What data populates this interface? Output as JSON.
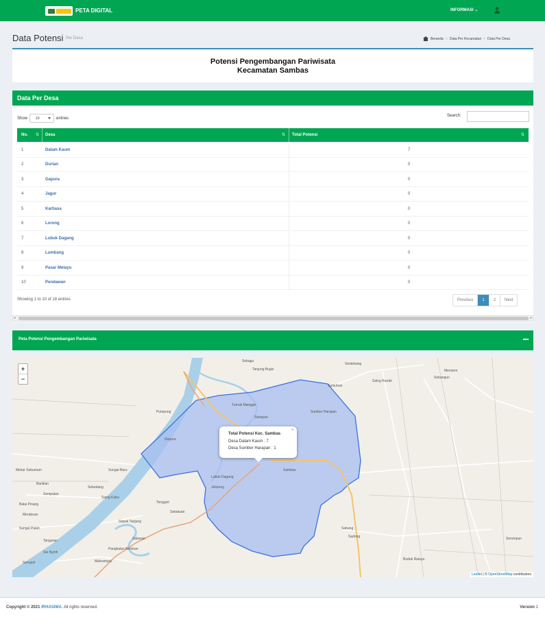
{
  "header": {
    "app_name": "PETA DIGITAL",
    "menu_label": "INFORMASI"
  },
  "page": {
    "title": "Data Potensi",
    "subtitle": "Per Desa"
  },
  "breadcrumb": [
    "Beranda",
    "Data Per Kecamatan",
    "Data Per Desa"
  ],
  "banner": {
    "line1": "Potensi Pengembangan Pariwisata",
    "line2": "Kecamatan Sambas"
  },
  "table_box": {
    "title": "Data Per Desa",
    "show_label": "Show",
    "entries_value": "10",
    "entries_label": "entries",
    "search_label": "Search:",
    "columns": [
      "No.",
      "Desa",
      "Total Potensi"
    ],
    "rows": [
      {
        "no": "1",
        "desa": "Dalam Kaum",
        "total": "7"
      },
      {
        "no": "2",
        "desa": "Durian",
        "total": "0"
      },
      {
        "no": "3",
        "desa": "Gapura",
        "total": "0"
      },
      {
        "no": "4",
        "desa": "Jagur",
        "total": "0"
      },
      {
        "no": "5",
        "desa": "Kartiasa",
        "total": "0"
      },
      {
        "no": "6",
        "desa": "Lorong",
        "total": "0"
      },
      {
        "no": "7",
        "desa": "Lubuk Dagang",
        "total": "0"
      },
      {
        "no": "8",
        "desa": "Lumbang",
        "total": "0"
      },
      {
        "no": "9",
        "desa": "Pasar Melayu",
        "total": "0"
      },
      {
        "no": "10",
        "desa": "Pendawan",
        "total": "0"
      }
    ],
    "info": "Showing 1 to 10 of 18 entries",
    "pagination": [
      "Previous",
      "1",
      "2",
      "Next"
    ]
  },
  "map_box": {
    "title": "Peta Potensi Pengembangan Pariwisata"
  },
  "map": {
    "zoom_in": "+",
    "zoom_out": "−",
    "popup": {
      "title": "Total Potensi Kec. Sambas",
      "line1": "Desa Dalam Kaum : 7",
      "line2": "Desa Sumber Harapan : 1"
    },
    "attribution": {
      "leaflet": "Leaflet",
      "sep": " | © ",
      "osm": "OpenStreetMap",
      "suffix": " contributors"
    },
    "place_labels": [
      "Sebagu",
      "Tanjung Bugis",
      "Gapura",
      "Sebayan",
      "Pumpung",
      "Sumber Harapan",
      "Sambas",
      "Jelutung",
      "Tumuk Manggis",
      "Lubuk Dagang",
      "Bantilan",
      "Sempalan",
      "Mekar Sekuntum",
      "Sungai Baru",
      "Sebangun",
      "Mensere",
      "Saing Rambi",
      "Sadong",
      "Balai Pinang",
      "Sei Nyirih",
      "Tengguli",
      "Sebatuan",
      "Pangkalan Bemban",
      "Sabung",
      "Sabaran",
      "Buduk Ralaya",
      "Merabuan",
      "Sungai Palah",
      "Sepuk Tanjung",
      "Tangaran",
      "Makrampai",
      "Senujuh",
      "Sebedang",
      "Saing Kubu",
      "Serumpun",
      "Sentebang",
      "Sumuhun"
    ],
    "colors": {
      "land": "#f2efe9",
      "river": "#a9d0e8",
      "polygon_fill": "#a7bff0",
      "polygon_stroke": "#3a6fe0",
      "road_main": "#e8a87c",
      "road_primary": "#f6c26a"
    }
  },
  "footer": {
    "copyright_prefix": "Copyright © 2021 ",
    "brand": "IRHASIMA",
    "copyright_suffix": ". All rights reserved.",
    "version_label": "Version",
    "version_value": "1"
  }
}
